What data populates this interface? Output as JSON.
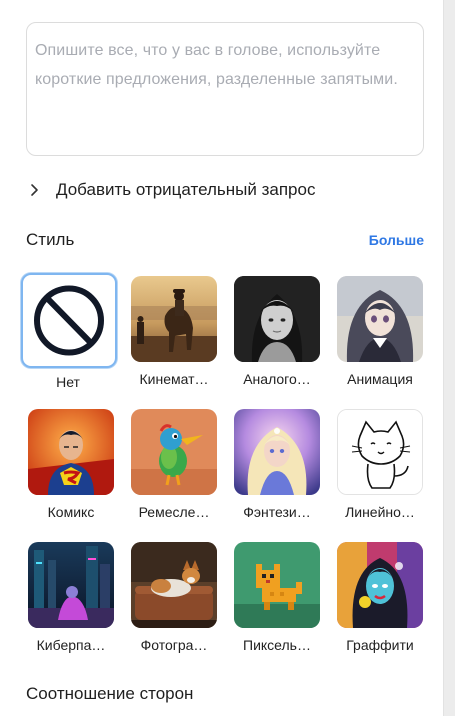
{
  "prompt": {
    "placeholder": "Опишите все, что у вас в голове, используйте короткие предложения, разделенные запятыми.",
    "value": ""
  },
  "negative_prompt": {
    "label": "Добавить отрицательный запрос"
  },
  "style_section": {
    "title": "Стиль",
    "more_label": "Больше",
    "selected": "Нет",
    "styles": [
      {
        "label": "Нет",
        "icon": "no-style-icon"
      },
      {
        "label": "Кинемат…",
        "icon": "cinematic-thumbnail"
      },
      {
        "label": "Аналого…",
        "icon": "analog-thumbnail"
      },
      {
        "label": "Анимация",
        "icon": "anime-thumbnail"
      },
      {
        "label": "Комикс",
        "icon": "comic-thumbnail"
      },
      {
        "label": "Ремесле…",
        "icon": "craft-thumbnail"
      },
      {
        "label": "Фэнтези…",
        "icon": "fantasy-thumbnail"
      },
      {
        "label": "Линейно…",
        "icon": "line-art-thumbnail"
      },
      {
        "label": "Киберпа…",
        "icon": "cyberpunk-thumbnail"
      },
      {
        "label": "Фотогра…",
        "icon": "photo-thumbnail"
      },
      {
        "label": "Пиксель…",
        "icon": "pixel-thumbnail"
      },
      {
        "label": "Граффити",
        "icon": "graffiti-thumbnail"
      }
    ]
  },
  "aspect_ratio": {
    "title": "Соотношение сторон"
  },
  "colors": {
    "accent": "#2f78e4",
    "selected_border": "#7fb6f0",
    "placeholder": "#a9acb3"
  }
}
